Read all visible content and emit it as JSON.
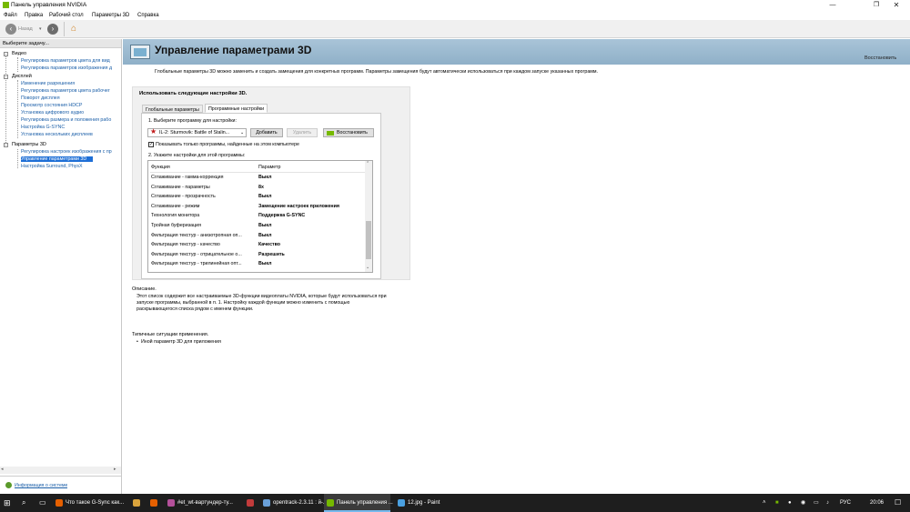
{
  "window": {
    "title": "Панель управления NVIDIA"
  },
  "menu": [
    "Файл",
    "Правка",
    "Рабочий стол",
    "Параметры 3D",
    "Справка"
  ],
  "toolbar": {
    "back_label": "Назад"
  },
  "left_panel": {
    "header": "Выберите задачу...",
    "tree": [
      {
        "label": "Видео",
        "items": [
          "Регулировка параметров цвета для вид",
          "Регулировка параметров изображения д"
        ]
      },
      {
        "label": "Дисплей",
        "items": [
          "Изменение разрешения",
          "Регулировка параметров цвета рабочег",
          "Поворот дисплея",
          "Просмотр состояния HDCP",
          "Установка цифрового аудио",
          "Регулировка размера и положения рабо",
          "Настройка G-SYNC",
          "Установка нескольких дисплеев"
        ]
      },
      {
        "label": "Параметры 3D",
        "items": [
          "Регулировка настроек изображения с пр",
          "Управление параметрами 3D",
          "Настройка Surround, PhysX"
        ]
      }
    ],
    "selected_item": "Управление параметрами 3D",
    "system_info_label": "Информация о системе"
  },
  "main": {
    "title": "Управление параметрами 3D",
    "restore_label": "Восстановить",
    "intro": "Глобальные параметры 3D можно заменить и создать замещения для конкретных программ. Параметры замещения будут автоматически использоваться при каждом запуске указанных программ.",
    "use_settings_label": "Использовать следующие настройки 3D.",
    "tabs": [
      "Глобальные параметры",
      "Программные настройки"
    ],
    "active_tab": 1,
    "step1_label": "1. Выберите программу для настройки:",
    "program_selected": "IL-2: Sturmovik: Battle of Stalin...",
    "add_button": "Добавить",
    "remove_button": "Удалить",
    "restore_button": "Восстановить",
    "show_only_checkbox": "Показывать только программы, найденные на этом компьютере",
    "show_only_checked": true,
    "step2_label": "2. Укажите настройки для этой программы:",
    "settings_headers": [
      "Функция",
      "Параметр"
    ],
    "settings_rows": [
      {
        "feature": "Сглаживание - гамма-коррекция",
        "value": "Выкл"
      },
      {
        "feature": "Сглаживание - параметры",
        "value": "8x"
      },
      {
        "feature": "Сглаживание - прозрачность",
        "value": "Выкл"
      },
      {
        "feature": "Сглаживание - режим",
        "value": "Замещение настроек приложения"
      },
      {
        "feature": "Технология монитора",
        "value": "Поддержка G-SYNC"
      },
      {
        "feature": "Тройная буферизация",
        "value": "Выкл"
      },
      {
        "feature": "Фильтрация текстур - анизотропная оп...",
        "value": "Выкл"
      },
      {
        "feature": "Фильтрация текстур - качество",
        "value": "Качество"
      },
      {
        "feature": "Фильтрация текстур - отрицательное о...",
        "value": "Разрешить"
      },
      {
        "feature": "Фильтрация текстур - трилинейная опт...",
        "value": "Выкл"
      }
    ],
    "description_header": "Описание.",
    "description_lines": [
      "Этот список содержит все настраиваемые 3D-функции видеоплаты NVIDIA, которые будут использоваться при",
      "запуске программы, выбранной в п.  1. Настройку каждой функции можно изменить с помощью",
      "раскрывающегося списка рядом с именем функции."
    ],
    "typical_header": "Типичные ситуации применения.",
    "typical_items": [
      "Иной параметр 3D для приложения"
    ]
  },
  "taskbar": {
    "apps": [
      {
        "label": "Что такое G-Sync как...",
        "color": "#e66000"
      },
      {
        "label": "",
        "color": "#d9a33c"
      },
      {
        "label": "",
        "color": "#e66000"
      },
      {
        "label": "#et_wt-вартундер-ту...",
        "color": "#b4509a"
      },
      {
        "label": "",
        "color": "#c23b3b"
      },
      {
        "label": "opentrack-2.3.11 : й-...",
        "color": "#6aa0d8"
      },
      {
        "label": "Панель управления ...",
        "color": "#76b900"
      },
      {
        "label": "12.jpg - Paint",
        "color": "#4aa0e0"
      }
    ],
    "lang": "РУС",
    "time": "20:06"
  }
}
